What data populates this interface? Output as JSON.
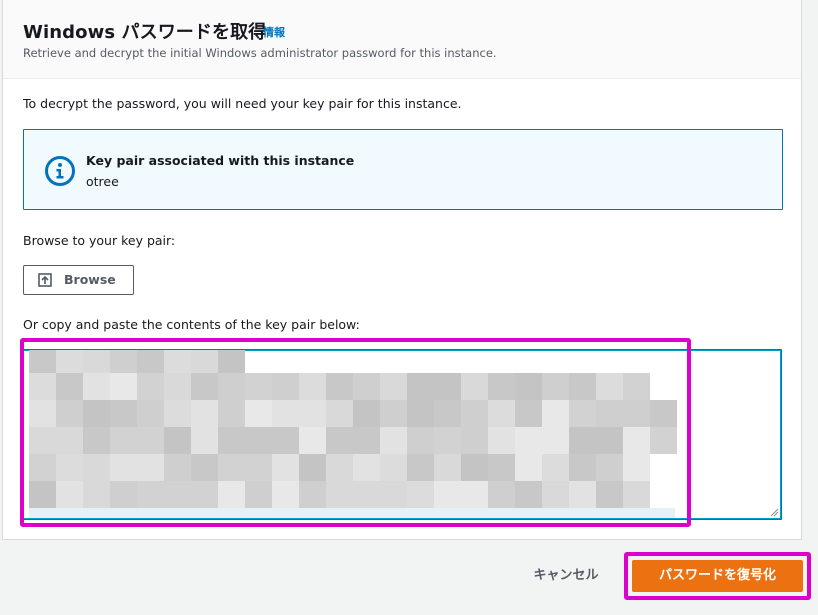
{
  "dialog": {
    "title": "Windows パスワードを取得",
    "info_link": "情報",
    "subtitle": "Retrieve and decrypt the initial Windows administrator password for this instance."
  },
  "body": {
    "intro": "To decrypt the password, you will need your key pair for this instance."
  },
  "alert": {
    "icon": "info-icon",
    "title": "Key pair associated with this instance",
    "key_pair_name": "otree",
    "accent_color": "#0073bb",
    "background_color": "#f1faff"
  },
  "browse": {
    "label": "Browse to your key pair:",
    "button_label": "Browse",
    "icon": "upload-icon"
  },
  "paste": {
    "label": "Or copy and paste the contents of the key pair below:",
    "content": "(redacted key pair contents – pixelated)"
  },
  "footer": {
    "cancel_label": "キャンセル",
    "submit_label": "パスワードを復号化",
    "submit_color": "#ec7211"
  },
  "annotation": {
    "highlight_color": "#dd00cc"
  }
}
